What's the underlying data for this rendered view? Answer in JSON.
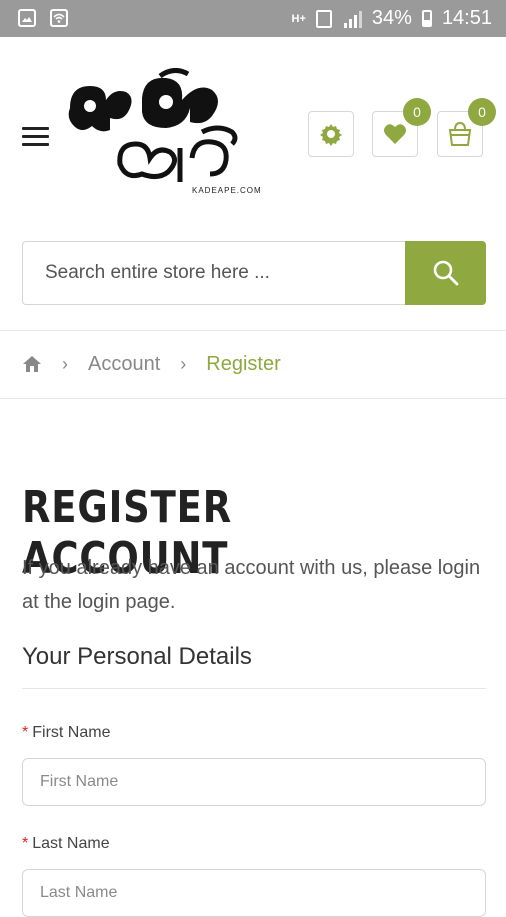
{
  "status_bar": {
    "network": "H+",
    "battery": "34%",
    "time": "14:51"
  },
  "header": {
    "logo_text": "කඩේ අපේ",
    "logo_sub": "KADEAPE.COM",
    "wishlist_count": "0",
    "cart_count": "0"
  },
  "search": {
    "placeholder": "Search entire store here ..."
  },
  "breadcrumb": {
    "items": [
      "Account",
      "Register"
    ]
  },
  "page": {
    "title": "REGISTER ACCOUNT",
    "intro": "If you already have an account with us, please login at the login page.",
    "section_title": "Your Personal Details"
  },
  "form": {
    "required_mark": "*",
    "first_name_label": "First Name",
    "first_name_placeholder": "First Name",
    "last_name_label": "Last Name",
    "last_name_placeholder": "Last Name"
  },
  "colors": {
    "accent": "#8fa83f",
    "required": "#e02020",
    "status_bar": "#9a9a9a"
  }
}
